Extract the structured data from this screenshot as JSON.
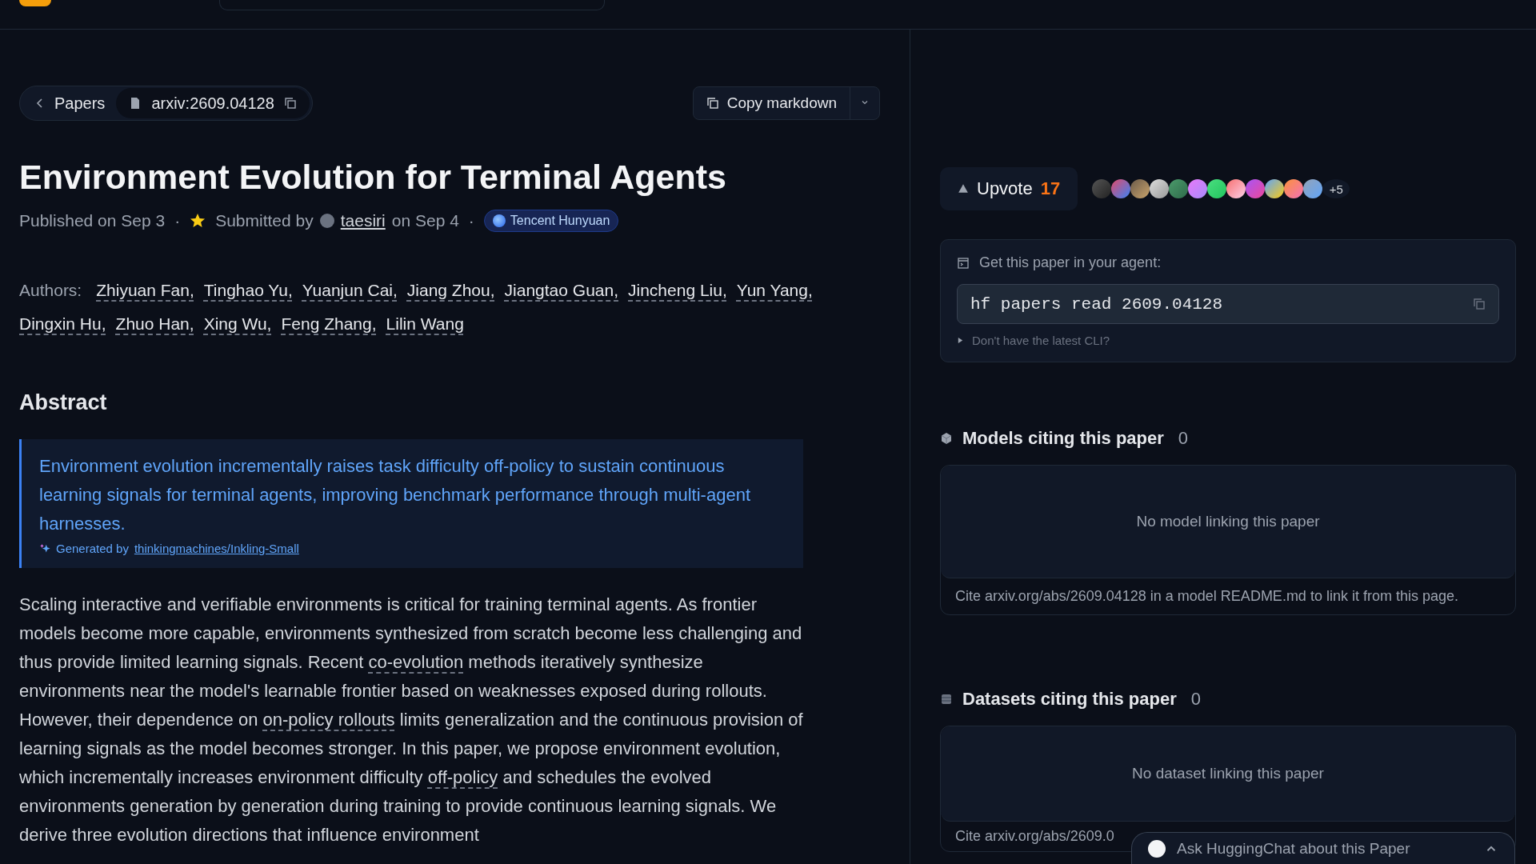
{
  "breadcrumb": {
    "back": "Papers",
    "paper_id": "arxiv:2609.04128"
  },
  "copy_button": "Copy markdown",
  "title": "Environment Evolution for Terminal Agents",
  "meta": {
    "separator": "·",
    "published": "Published on Sep 3",
    "submitted_prefix": "Submitted by",
    "submitter": "taesiri",
    "submitted_suffix": "on Sep 4",
    "organization": "Tencent Hunyuan"
  },
  "authors_label": "Authors:",
  "authors": [
    "Zhiyuan Fan,",
    "Tinghao Yu,",
    "Yuanjun Cai,",
    "Jiang Zhou,",
    "Jiangtao Guan,",
    "Jincheng Liu,",
    "Yun Yang,",
    "Dingxin Hu,",
    "Zhuo Han,",
    "Xing Wu,",
    "Feng Zhang,",
    "Lilin Wang"
  ],
  "abstract_heading": "Abstract",
  "summary": {
    "text": "Environment evolution incrementally raises task difficulty off-policy to sustain continuous learning signals for terminal agents, improving benchmark performance through multi-agent harnesses.",
    "generated_by": "Generated by",
    "model": "thinkingmachines/Inkling-Small"
  },
  "abstract": [
    {
      "kind": "text",
      "text": "Scaling interactive and verifiable environments is critical for training terminal agents. As frontier models become more capable, environments synthesized from scratch become less challenging and thus provide limited learning signals. Recent "
    },
    {
      "kind": "term",
      "text": "co-evolution"
    },
    {
      "kind": "text",
      "text": " methods iteratively synthesize environments near the model's learnable frontier based on weaknesses exposed during rollouts. However, their dependence on "
    },
    {
      "kind": "term",
      "text": "on-policy rollouts"
    },
    {
      "kind": "text",
      "text": " limits generalization and the continuous provision of learning signals as the model becomes stronger. In this paper, we propose environment evolution, which incrementally increases environment difficulty "
    },
    {
      "kind": "term",
      "text": "off-policy"
    },
    {
      "kind": "text",
      "text": " and schedules the evolved environments generation by generation during training to provide continuous learning signals. We derive three evolution directions that influence environment"
    }
  ],
  "upvote": {
    "label": "Upvote",
    "count": "17",
    "more_voters": "+5"
  },
  "agent": {
    "label": "Get this paper in your agent:",
    "command": "hf papers read 2609.04128",
    "cli_hint": "Don't have the latest CLI?"
  },
  "sections": [
    {
      "kind": "models",
      "title": "Models citing this paper",
      "count": "0",
      "empty": "No model linking this paper",
      "cite": "Cite arxiv.org/abs/2609.04128 in a model README.md to link it from this page."
    },
    {
      "kind": "datasets",
      "title": "Datasets citing this paper",
      "count": "0",
      "empty": "No dataset linking this paper",
      "cite": "Cite arxiv.org/abs/2609.0"
    }
  ],
  "chat": {
    "placeholder": "Ask HuggingChat about this Paper"
  }
}
